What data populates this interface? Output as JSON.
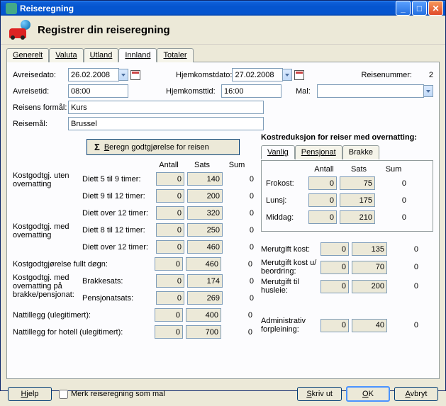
{
  "window": {
    "title": "Reiseregning"
  },
  "header": {
    "title": "Registrer din reiseregning"
  },
  "tabs": [
    "Generelt",
    "Valuta",
    "Utland",
    "Innland",
    "Totaler"
  ],
  "activeTab": "Innland",
  "top": {
    "avreisedato_lbl": "Avreisedato:",
    "avreisedato": "26.02.2008",
    "hjemkomstdato_lbl": "Hjemkomstdato:",
    "hjemkomstdato": "27.02.2008",
    "reisenummer_lbl": "Reisenummer:",
    "reisenummer": "2",
    "avreisetid_lbl": "Avreisetid:",
    "avreisetid": "08:00",
    "hjemkomsttid_lbl": "Hjemkomsttid:",
    "hjemkomsttid": "16:00",
    "mal_lbl": "Mal:",
    "mal": "",
    "formal_lbl": "Reisens formål:",
    "formal": "Kurs",
    "reisemal_lbl": "Reisemål:",
    "reisemal": "Brussel"
  },
  "calcBtn": "Beregn godtgjørelse for reisen",
  "headers": {
    "antall": "Antall",
    "sats": "Sats",
    "sum": "Sum"
  },
  "left": {
    "grp1": "Kostgodtgj. uten overnatting",
    "r1": {
      "d": "Diett 5 til 9 timer:",
      "a": "0",
      "s": "140",
      "sum": "0"
    },
    "r2": {
      "d": "Diett 9 til 12 timer:",
      "a": "0",
      "s": "200",
      "sum": "0"
    },
    "r3": {
      "d": "Diett over 12 timer:",
      "a": "0",
      "s": "320",
      "sum": "0"
    },
    "grp2": "Kostgodtgj. med overnatting",
    "r4": {
      "d": "Diett 8 til 12 timer:",
      "a": "0",
      "s": "250",
      "sum": "0"
    },
    "r5": {
      "d": "Diett over 12 timer:",
      "a": "0",
      "s": "460",
      "sum": "0"
    },
    "r6": {
      "d": "Kostgodtgjørelse fullt døgn:",
      "a": "0",
      "s": "460",
      "sum": "0"
    },
    "grp3": "Kostgodtgj. med overnatting på brakke/pensjonat:",
    "r7": {
      "d": "Brakkesats:",
      "a": "0",
      "s": "174",
      "sum": "0"
    },
    "r8": {
      "d": "Pensjonatsats:",
      "a": "0",
      "s": "269",
      "sum": "0"
    },
    "r9": {
      "d": "Nattillegg (ulegitimert):",
      "a": "0",
      "s": "400",
      "sum": "0"
    },
    "r10": {
      "d": "Nattillegg for hotell (ulegitimert):",
      "a": "0",
      "s": "700",
      "sum": "0"
    }
  },
  "right": {
    "groupTitle": "Kostreduksjon for reiser med overnatting:",
    "tabs": [
      "Vanlig",
      "Pensjonat",
      "Brakke"
    ],
    "frokost": {
      "d": "Frokost:",
      "a": "0",
      "s": "75",
      "sum": "0"
    },
    "lunsj": {
      "d": "Lunsj:",
      "a": "0",
      "s": "175",
      "sum": "0"
    },
    "middag": {
      "d": "Middag:",
      "a": "0",
      "s": "210",
      "sum": "0"
    },
    "m1": {
      "d": "Merutgift kost:",
      "a": "0",
      "s": "135",
      "sum": "0"
    },
    "m2": {
      "d": "Merutgift kost u/ beordring:",
      "a": "0",
      "s": "70",
      "sum": "0"
    },
    "m3": {
      "d": "Merutgift til husleie:",
      "a": "0",
      "s": "200",
      "sum": "0"
    },
    "m4": {
      "d": "Administrativ forpleining:",
      "a": "0",
      "s": "40",
      "sum": "0"
    }
  },
  "footer": {
    "hjelp": "Hjelp",
    "merk": "Merk reiseregning som mal",
    "skriv": "Skriv ut",
    "ok": "OK",
    "avbryt": "Avbryt"
  }
}
